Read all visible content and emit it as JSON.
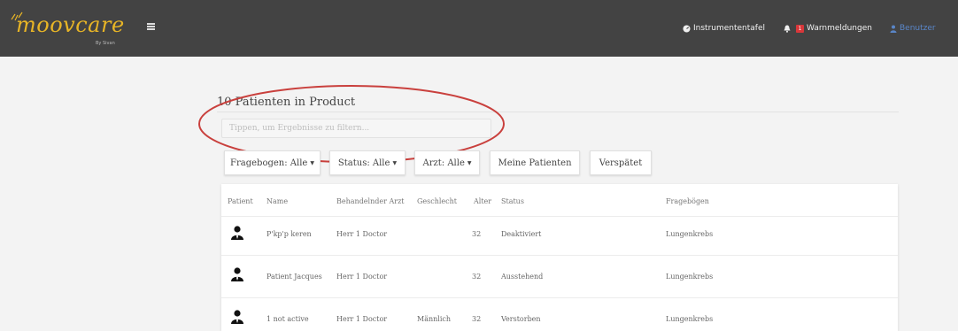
{
  "header": {
    "logo_text": "moovcare",
    "logo_sub": "By Sivan",
    "nav": {
      "dashboard_label": "Instrumententafel",
      "alerts_label": "Warnmeldungen",
      "alerts_count": "1",
      "user_label": "Benutzer"
    }
  },
  "main": {
    "title": "10 Patienten in Product",
    "filter": {
      "placeholder": "Tippen, um Ergebnisse zu filtern..."
    },
    "buttons": {
      "questionnaires": "Fragebogen: Alle",
      "status": "Status: Alle",
      "doctor": "Arzt: Alle",
      "my_patients": "Meine Patienten",
      "late": "Verspätet"
    },
    "table": {
      "columns": [
        "Patient",
        "Name",
        "Behandelnder Arzt",
        "Geschlecht",
        "Alter",
        "Status",
        "Fragebögen"
      ],
      "rows": [
        {
          "name": "P'kp'p keren",
          "doctor": "Herr 1 Doctor",
          "gender": "",
          "age": "32",
          "status": "Deaktiviert",
          "questionnaire": "Lungenkrebs"
        },
        {
          "name": "Patient Jacques",
          "doctor": "Herr 1 Doctor",
          "gender": "",
          "age": "32",
          "status": "Ausstehend",
          "questionnaire": "Lungenkrebs"
        },
        {
          "name": "1 not active",
          "doctor": "Herr 1 Doctor",
          "gender": "Männlich",
          "age": "32",
          "status": "Verstorben",
          "questionnaire": "Lungenkrebs"
        }
      ]
    }
  },
  "colors": {
    "header_bg": "#434343",
    "logo": "#e8b526",
    "highlight": "#c9403d",
    "badge": "#d9373a",
    "user_link": "#5a86c8"
  }
}
